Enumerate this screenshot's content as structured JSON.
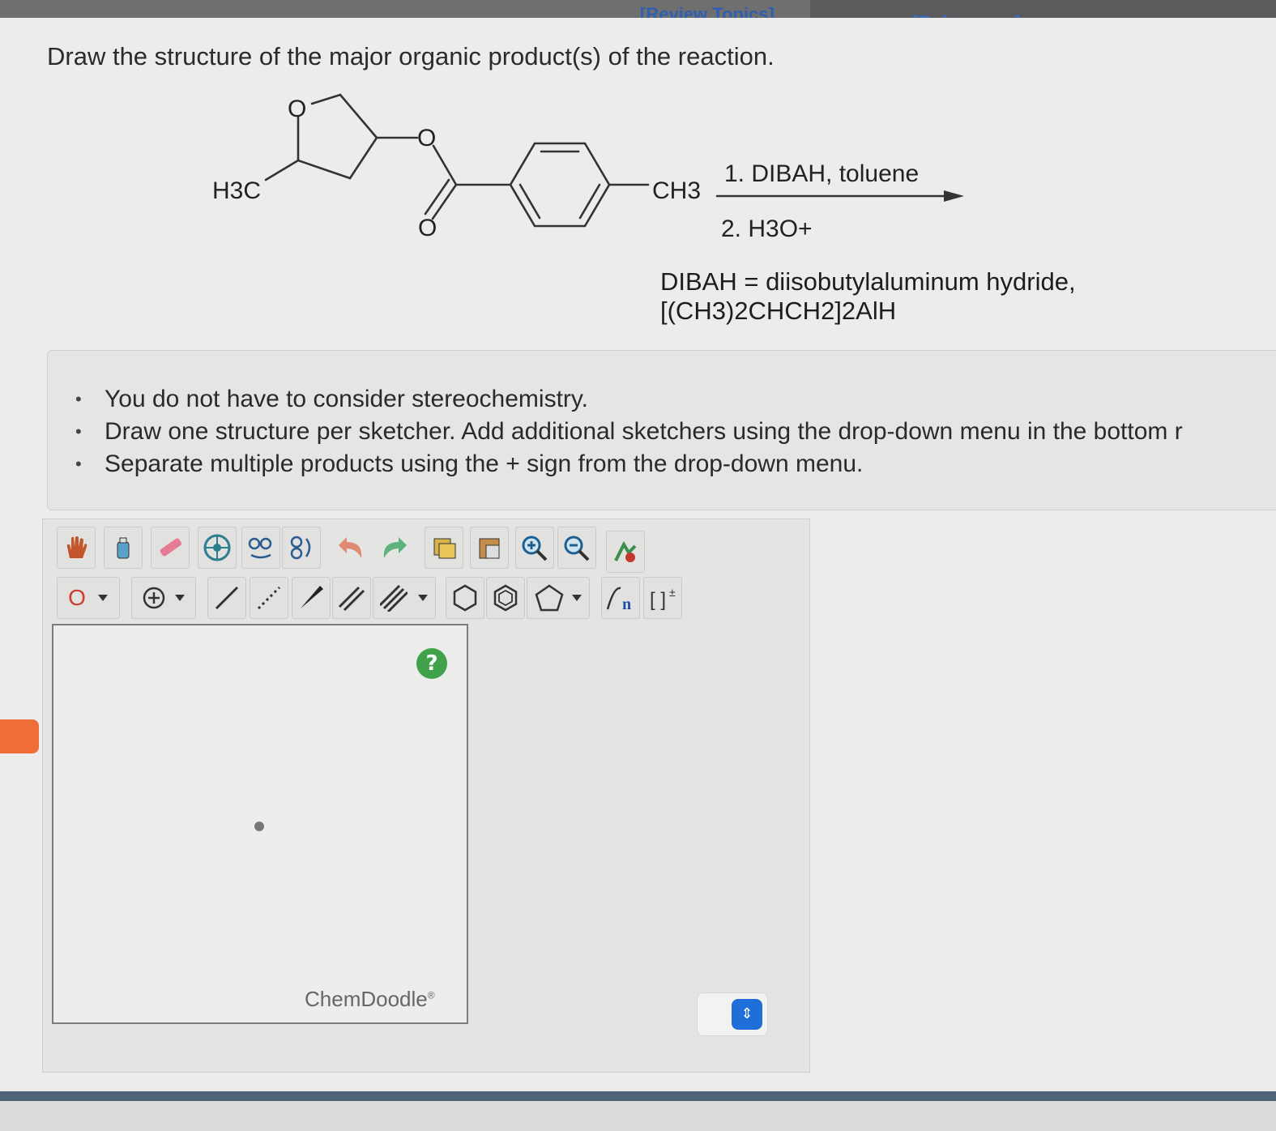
{
  "header": {
    "review_topics": "[Review Topics]",
    "references": "[References]"
  },
  "question": {
    "title": "Draw the structure of the major organic product(s) of the reaction."
  },
  "reaction": {
    "substituent_left": "H3C",
    "substituent_right": "CH3",
    "step1": "1. DIBAH, toluene",
    "step2": "2. H3O+",
    "dibah_definition": "DIBAH = diisobutylaluminum hydride,",
    "dibah_formula": "[(CH3)2CHCH2]2AlH"
  },
  "notes": [
    "You do not have to consider stereochemistry.",
    "Draw one structure per sketcher. Add additional sketchers using the drop-down menu in the bottom r",
    "Separate multiple products using the + sign from the drop-down menu."
  ],
  "sketcher": {
    "element_selector": "O",
    "help_label": "?",
    "brand": "ChemDoodle",
    "brand_mark": "®",
    "toolbar_row1": [
      "hand-tool",
      "lasso-tool",
      "eraser-tool",
      "center-tool",
      "clean-tool",
      "rotate-tool",
      "undo",
      "redo",
      "copy",
      "paste",
      "zoom-in",
      "zoom-out",
      "settings"
    ],
    "toolbar_row2": [
      "element-selector",
      "charge-tool",
      "single-bond",
      "dashed-bond",
      "wedge-bond",
      "double-bond",
      "triple-bond",
      "benzene-ring",
      "cyclohexane-ring",
      "cyclopentane-ring",
      "repeat-unit",
      "bracket-charge"
    ]
  },
  "colors": {
    "link": "#2e5fb0",
    "help_button": "#3fa24a",
    "stepper": "#1f6fd8",
    "orange_tab": "#ef6d36"
  }
}
